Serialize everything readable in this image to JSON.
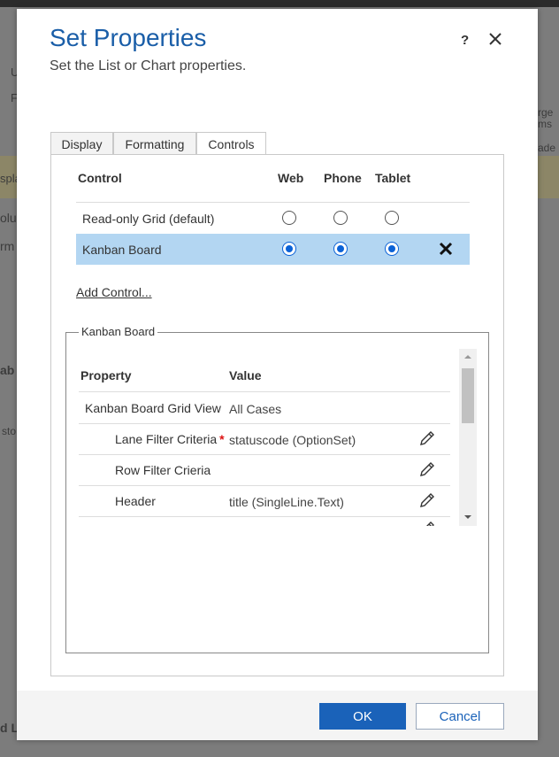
{
  "dialog": {
    "title": "Set Properties",
    "subtitle": "Set the List or Chart properties.",
    "help_glyph": "?",
    "tabs": [
      {
        "label": "Display"
      },
      {
        "label": "Formatting"
      },
      {
        "label": "Controls",
        "active": true
      }
    ]
  },
  "controls_table": {
    "headers": {
      "control": "Control",
      "web": "Web",
      "phone": "Phone",
      "tablet": "Tablet"
    },
    "rows": [
      {
        "label": "Read-only Grid (default)",
        "web": false,
        "phone": false,
        "tablet": false,
        "selected": false
      },
      {
        "label": "Kanban Board",
        "web": true,
        "phone": true,
        "tablet": true,
        "selected": true
      }
    ],
    "add_control_label": "Add Control..."
  },
  "kanban_section": {
    "legend": "Kanban Board",
    "headers": {
      "property": "Property",
      "value": "Value"
    },
    "rows": [
      {
        "property": "Kanban Board Grid View",
        "value": "All Cases",
        "required": false,
        "editable": false
      },
      {
        "property": "Lane Filter Criteria",
        "value": "statuscode (OptionSet)",
        "required": true,
        "editable": true
      },
      {
        "property": "Row Filter Crieria",
        "value": "",
        "required": false,
        "editable": true
      },
      {
        "property": "Header",
        "value": "title (SingleLine.Text)",
        "required": false,
        "editable": true
      }
    ],
    "required_marker": "*"
  },
  "footer": {
    "ok_label": "OK",
    "cancel_label": "Cancel"
  },
  "background": {
    "fragments": [
      "U",
      "F",
      "spla",
      "olu",
      "rm",
      "ab",
      "sto",
      "d L",
      "rge",
      "ms",
      "ade"
    ]
  },
  "colors": {
    "accent": "#1a62b9",
    "title": "#1a5ea8",
    "selected_row": "#b3d6f2",
    "radio_on": "#0b62d6",
    "required": "#dd1111"
  }
}
